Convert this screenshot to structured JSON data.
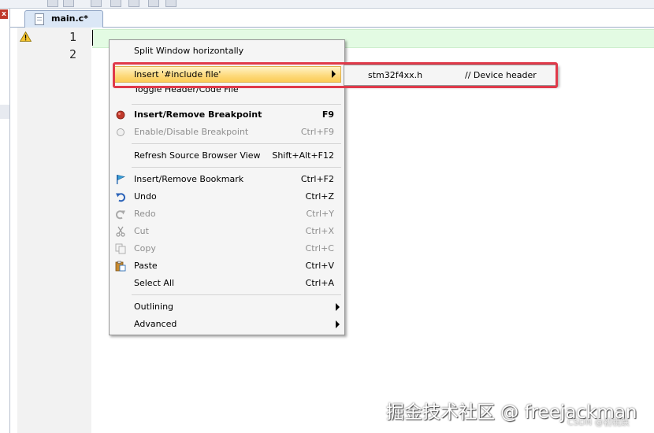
{
  "editor": {
    "tab_label": "main.c*",
    "line_numbers": [
      "1",
      "2"
    ]
  },
  "context_menu": {
    "items": [
      {
        "label": "Split Window horizontally",
        "shortcut": ""
      },
      {
        "label": "Insert '#include file'",
        "shortcut": ""
      },
      {
        "label": "Toggle Header/Code File",
        "shortcut": ""
      },
      {
        "label": "Insert/Remove Breakpoint",
        "shortcut": "F9"
      },
      {
        "label": "Enable/Disable Breakpoint",
        "shortcut": "Ctrl+F9"
      },
      {
        "label": "Refresh Source Browser View",
        "shortcut": "Shift+Alt+F12"
      },
      {
        "label": "Insert/Remove Bookmark",
        "shortcut": "Ctrl+F2"
      },
      {
        "label": "Undo",
        "shortcut": "Ctrl+Z"
      },
      {
        "label": "Redo",
        "shortcut": "Ctrl+Y"
      },
      {
        "label": "Cut",
        "shortcut": "Ctrl+X"
      },
      {
        "label": "Copy",
        "shortcut": "Ctrl+C"
      },
      {
        "label": "Paste",
        "shortcut": "Ctrl+V"
      },
      {
        "label": "Select All",
        "shortcut": "Ctrl+A"
      },
      {
        "label": "Outlining",
        "shortcut": ""
      },
      {
        "label": "Advanced",
        "shortcut": ""
      }
    ]
  },
  "submenu": {
    "file": "stm32f4xx.h",
    "comment": "// Device header"
  },
  "watermark": {
    "main": "掘金技术社区 @ freejackman",
    "small": "CSDN @初稅跌"
  },
  "icons": {
    "warning": "warning-icon",
    "breakpoint": "breakpoint-red-dot-icon",
    "breakpoint_disabled": "breakpoint-hollow-icon",
    "bookmark": "bookmark-flag-icon",
    "undo": "undo-icon",
    "redo": "redo-icon",
    "cut": "scissors-icon",
    "copy": "copy-icon",
    "paste": "paste-icon"
  },
  "colors": {
    "highlight_box": "#e03a4a",
    "menu_hover": "#fdd97a",
    "current_line": "#e3fbe3",
    "breakpoint": "#c0392b"
  }
}
